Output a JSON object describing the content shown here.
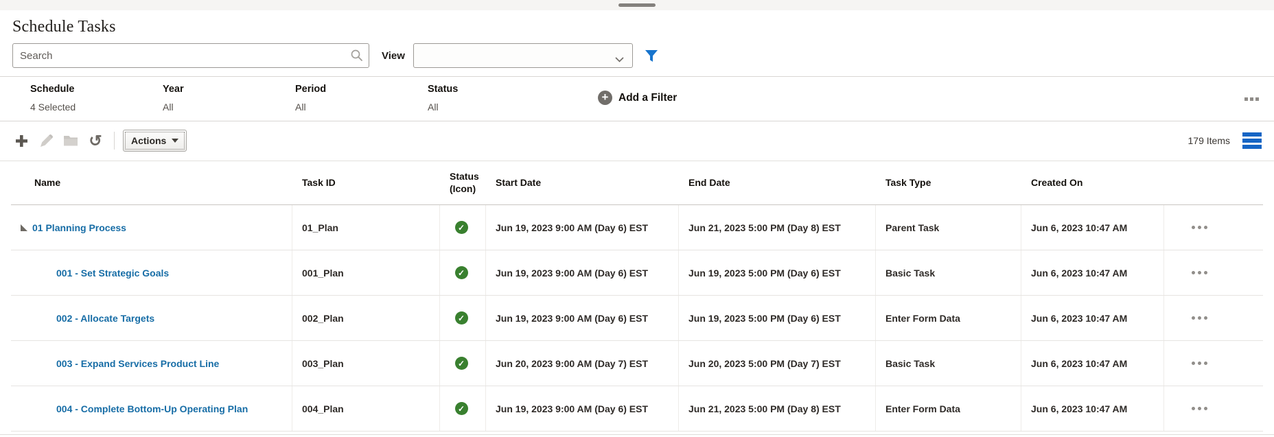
{
  "page_title": "Schedule Tasks",
  "search": {
    "placeholder": "Search"
  },
  "view_control": {
    "label": "View",
    "selected_value": ""
  },
  "filter_bar": {
    "filters": [
      {
        "label": "Schedule",
        "value": "4 Selected"
      },
      {
        "label": "Year",
        "value": "All"
      },
      {
        "label": "Period",
        "value": "All"
      },
      {
        "label": "Status",
        "value": "All"
      }
    ],
    "add_filter_label": "Add a Filter"
  },
  "toolbar": {
    "buttons": [
      {
        "icon": "add-icon",
        "enabled": true
      },
      {
        "icon": "edit-pencil-icon",
        "enabled": false
      },
      {
        "icon": "folder-icon",
        "enabled": false
      },
      {
        "icon": "refresh-icon",
        "enabled": true
      }
    ],
    "actions_button_label": "Actions",
    "items_count_label": "179 Items"
  },
  "table": {
    "columns": [
      "Name",
      "Task ID",
      "Status (Icon)",
      "Start Date",
      "End Date",
      "Task Type",
      "Created On"
    ],
    "rows": [
      {
        "name": "01 Planning Process",
        "expandable": true,
        "indent": 0,
        "task_id": "01_Plan",
        "status": "success",
        "start_date": "Jun 19, 2023 9:00 AM (Day 6) EST",
        "end_date": "Jun 21, 2023 5:00 PM (Day 8) EST",
        "task_type": "Parent Task",
        "created_on": "Jun 6, 2023 10:47 AM"
      },
      {
        "name": "001 - Set Strategic Goals",
        "expandable": false,
        "indent": 1,
        "task_id": "001_Plan",
        "status": "success",
        "start_date": "Jun 19, 2023 9:00 AM (Day 6) EST",
        "end_date": "Jun 19, 2023 5:00 PM (Day 6) EST",
        "task_type": "Basic Task",
        "created_on": "Jun 6, 2023 10:47 AM"
      },
      {
        "name": "002 - Allocate Targets",
        "expandable": false,
        "indent": 1,
        "task_id": "002_Plan",
        "status": "success",
        "start_date": "Jun 19, 2023 9:00 AM (Day 6) EST",
        "end_date": "Jun 19, 2023 5:00 PM (Day 6) EST",
        "task_type": "Enter Form Data",
        "created_on": "Jun 6, 2023 10:47 AM"
      },
      {
        "name": "003 - Expand Services Product Line",
        "expandable": false,
        "indent": 1,
        "task_id": "003_Plan",
        "status": "success",
        "start_date": "Jun 20, 2023 9:00 AM (Day 7) EST",
        "end_date": "Jun 20, 2023 5:00 PM (Day 7) EST",
        "task_type": "Basic Task",
        "created_on": "Jun 6, 2023 10:47 AM"
      },
      {
        "name": "004 - Complete Bottom-Up Operating Plan",
        "expandable": false,
        "indent": 1,
        "task_id": "004_Plan",
        "status": "success",
        "start_date": "Jun 19, 2023 9:00 AM (Day 6) EST",
        "end_date": "Jun 21, 2023 5:00 PM (Day 8) EST",
        "task_type": "Enter Form Data",
        "created_on": "Jun 6, 2023 10:47 AM"
      }
    ]
  },
  "colors": {
    "accent_blue": "#1774cd",
    "link_blue": "#176da6",
    "status_green": "#39802f"
  }
}
